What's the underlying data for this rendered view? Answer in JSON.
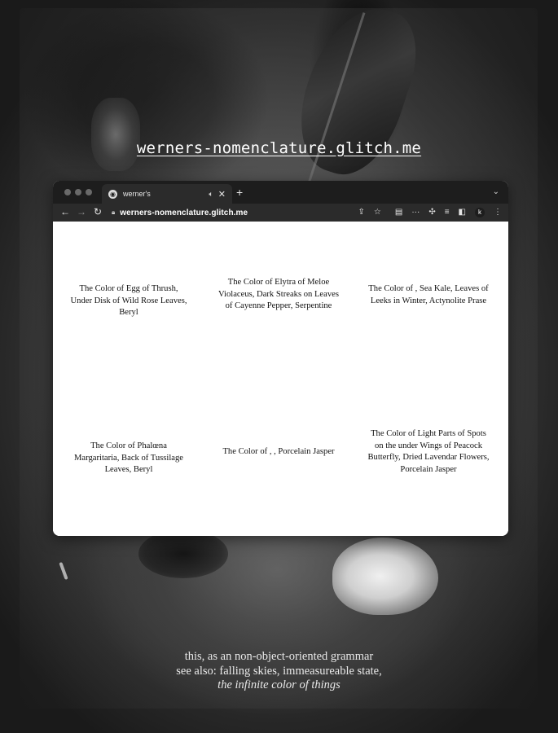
{
  "header": {
    "link_text": "werners-nomenclature.glitch.me"
  },
  "browser": {
    "tab": {
      "title": "werner's",
      "favicon": "globe-icon",
      "audio_icon": "speaker-icon"
    },
    "toolbar": {
      "url": "werners-nomenclature.glitch.me",
      "profile_initial": "k"
    }
  },
  "colors": [
    {
      "text": "The Color of Egg of Thrush, Under Disk of Wild Rose Leaves, Beryl"
    },
    {
      "text": "The Color of Elytra of Meloe Violaceus, Dark Streaks on Leaves of Cayenne Pepper, Serpentine"
    },
    {
      "text": "The Color of , Sea Kale, Leaves of Leeks in Winter, Actynolite Prase"
    },
    {
      "text": "The Color of Phalœna Margaritaria, Back of Tussilage Leaves, Beryl"
    },
    {
      "text": "The Color of , , Porcelain Jasper"
    },
    {
      "text": "The Color of Light Parts of Spots on the under Wings of Peacock Butterfly, Dried Lavendar Flowers, Porcelain Jasper"
    }
  ],
  "caption": {
    "line1": "this, as an non-object-oriented grammar",
    "line2": "see also: falling skies, immeasureable state,",
    "line3": "the infinite color of things"
  },
  "palette": {
    "background": "#151515",
    "window_chrome": "#1d1d1d",
    "toolbar": "#2b2b2b",
    "page": "#ffffff",
    "text_light": "#e9e9e9"
  }
}
